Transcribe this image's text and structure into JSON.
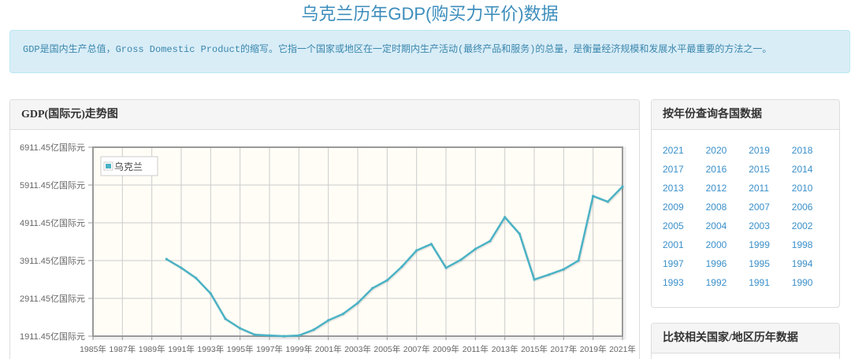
{
  "theme": {
    "title_color": "#3c8dbc",
    "info_bg": "#d9edf7",
    "info_border": "#bce8f1",
    "info_text": "#3a87ad",
    "link_color": "#3a8fc9"
  },
  "page": {
    "title": "乌克兰历年GDP(购买力平价)数据"
  },
  "info": {
    "text": "GDP是国内生产总值，Gross Domestic Product的缩写。它指一个国家或地区在一定时期内生产活动(最终产品和服务)的总量，是衡量经济规模和发展水平最重要的方法之一。"
  },
  "year_query": {
    "title": "按年份查询各国数据",
    "years": [
      "2021",
      "2020",
      "2019",
      "2018",
      "2017",
      "2016",
      "2015",
      "2014",
      "2013",
      "2012",
      "2011",
      "2010",
      "2009",
      "2008",
      "2007",
      "2006",
      "2005",
      "2004",
      "2003",
      "2002",
      "2001",
      "2000",
      "1999",
      "1998",
      "1997",
      "1996",
      "1995",
      "1994",
      "1993",
      "1992",
      "1991",
      "1990"
    ]
  },
  "compare": {
    "title": "比较相关国家/地区历年数据"
  },
  "chart_data": {
    "type": "line",
    "title": "GDP(国际元)走势图",
    "x": [
      1990,
      1991,
      1992,
      1993,
      1994,
      1995,
      1996,
      1997,
      1998,
      1999,
      2000,
      2001,
      2002,
      2003,
      2004,
      2005,
      2006,
      2007,
      2008,
      2009,
      2010,
      2011,
      2012,
      2013,
      2014,
      2015,
      2016,
      2017,
      2018,
      2019,
      2020,
      2021
    ],
    "series": [
      {
        "name": "乌克兰",
        "color": "#4bb2c5",
        "values": [
          3950,
          3720,
          3450,
          3040,
          2370,
          2120,
          1950,
          1930,
          1911.45,
          1930,
          2080,
          2330,
          2500,
          2790,
          3180,
          3390,
          3750,
          4180,
          4350,
          3720,
          3930,
          4220,
          4430,
          5060,
          4620,
          3410,
          3540,
          3680,
          3910,
          5620,
          5470,
          5870
        ]
      }
    ],
    "xlim": [
      1985,
      2021
    ],
    "ylim": [
      1911.45,
      6911.45
    ],
    "x_ticks": [
      1985,
      1987,
      1989,
      1991,
      1993,
      1995,
      1997,
      1999,
      2001,
      2003,
      2005,
      2007,
      2009,
      2011,
      2013,
      2015,
      2017,
      2019,
      2021
    ],
    "x_tick_labels": [
      "1985年",
      "1987年",
      "1989年",
      "1991年",
      "1993年",
      "1995年",
      "1997年",
      "1999年",
      "2001年",
      "2003年",
      "2005年",
      "2007年",
      "2009年",
      "2011年",
      "2013年",
      "2015年",
      "2017年",
      "2019年",
      "2021年"
    ],
    "y_ticks": [
      1911.45,
      2911.45,
      3911.45,
      4911.45,
      5911.45,
      6911.45
    ],
    "y_tick_labels": [
      "1911.45亿国际元",
      "2911.45亿国际元",
      "3911.45亿国际元",
      "4911.45亿国际元",
      "5911.45亿国际元",
      "6911.45亿国际元"
    ],
    "grid": true,
    "grid_background": "#fffdf6",
    "legend_position": "top-left"
  }
}
